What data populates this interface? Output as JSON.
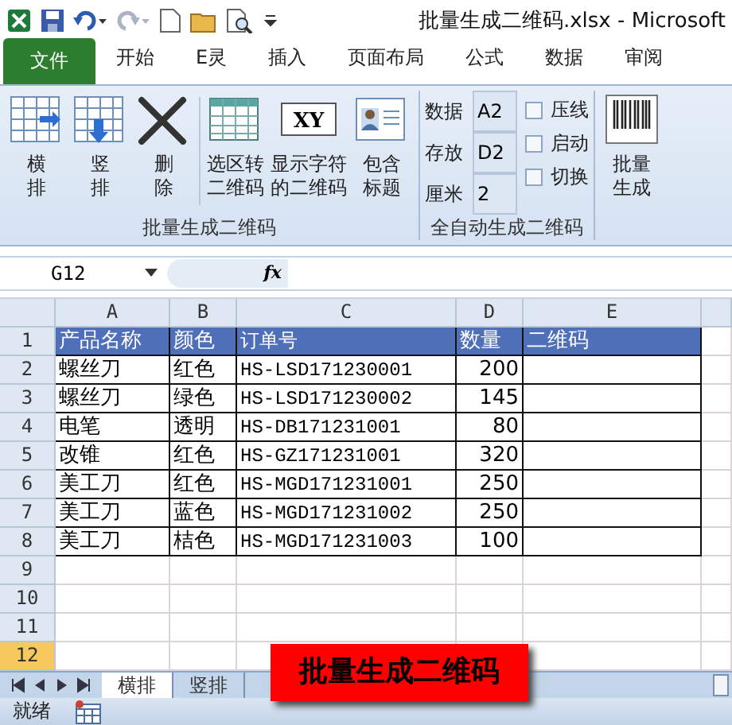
{
  "window": {
    "title": "批量生成二维码.xlsx  -  Microsoft"
  },
  "ribbon_tabs": [
    {
      "label": "文件",
      "kind": "file"
    },
    {
      "label": "开始",
      "kind": "tab"
    },
    {
      "label": "E灵",
      "kind": "tab"
    },
    {
      "label": "插入",
      "kind": "tab"
    },
    {
      "label": "页面布局",
      "kind": "tab"
    },
    {
      "label": "公式",
      "kind": "tab"
    },
    {
      "label": "数据",
      "kind": "tab"
    },
    {
      "label": "审阅",
      "kind": "tab"
    }
  ],
  "group_batch": {
    "label": "批量生成二维码",
    "buttons": [
      {
        "lines": [
          "横",
          "排"
        ]
      },
      {
        "lines": [
          "竖",
          "排"
        ]
      },
      {
        "lines": [
          "删",
          "除"
        ]
      },
      {
        "lines": [
          "选区转",
          "二维码"
        ]
      },
      {
        "lines": [
          "显示字符",
          "的二维码"
        ],
        "icon_text": "XY"
      },
      {
        "lines": [
          "包含",
          "标题"
        ]
      }
    ]
  },
  "group_auto": {
    "label": "全自动生成二维码",
    "fields": [
      {
        "label": "数据",
        "value": "A2"
      },
      {
        "label": "存放",
        "value": "D2"
      },
      {
        "label": "厘米",
        "value": "2"
      }
    ],
    "checkboxes": [
      {
        "label": "压线",
        "checked": false
      },
      {
        "label": "启动",
        "checked": false
      },
      {
        "label": "切换",
        "checked": false
      }
    ]
  },
  "group_generate": {
    "buttons": [
      {
        "lines": [
          "批量",
          "生成"
        ]
      }
    ]
  },
  "formula_bar": {
    "name_box": "G12",
    "fx_label": "fx"
  },
  "sheet": {
    "columns": [
      "A",
      "B",
      "C",
      "D",
      "E"
    ],
    "rows": [
      {
        "number": "1",
        "selected": false,
        "cells": [
          "产品名称",
          "颜色",
          "订单号",
          "数量",
          "二维码"
        ]
      },
      {
        "number": "2",
        "selected": false,
        "cells": [
          "螺丝刀",
          "红色",
          "HS-LSD171230001",
          "200",
          ""
        ]
      },
      {
        "number": "3",
        "selected": false,
        "cells": [
          "螺丝刀",
          "绿色",
          "HS-LSD171230002",
          "145",
          ""
        ]
      },
      {
        "number": "4",
        "selected": false,
        "cells": [
          "电笔",
          "透明",
          "HS-DB171231001",
          "80",
          ""
        ]
      },
      {
        "number": "5",
        "selected": false,
        "cells": [
          "改锥",
          "红色",
          "HS-GZ171231001",
          "320",
          ""
        ]
      },
      {
        "number": "6",
        "selected": false,
        "cells": [
          "美工刀",
          "红色",
          "HS-MGD171231001",
          "250",
          ""
        ]
      },
      {
        "number": "7",
        "selected": false,
        "cells": [
          "美工刀",
          "蓝色",
          "HS-MGD171231002",
          "250",
          ""
        ]
      },
      {
        "number": "8",
        "selected": false,
        "cells": [
          "美工刀",
          "桔色",
          "HS-MGD171231003",
          "100",
          ""
        ]
      },
      {
        "number": "9",
        "selected": false,
        "cells": []
      },
      {
        "number": "10",
        "selected": false,
        "cells": []
      },
      {
        "number": "11",
        "selected": false,
        "cells": []
      },
      {
        "number": "12",
        "selected": true,
        "cells": []
      }
    ]
  },
  "sheet_tabs": [
    {
      "label": "横排",
      "selected": true
    },
    {
      "label": "竖排",
      "selected": false
    }
  ],
  "status_bar": {
    "text": "就绪"
  },
  "caption": "批量生成二维码"
}
